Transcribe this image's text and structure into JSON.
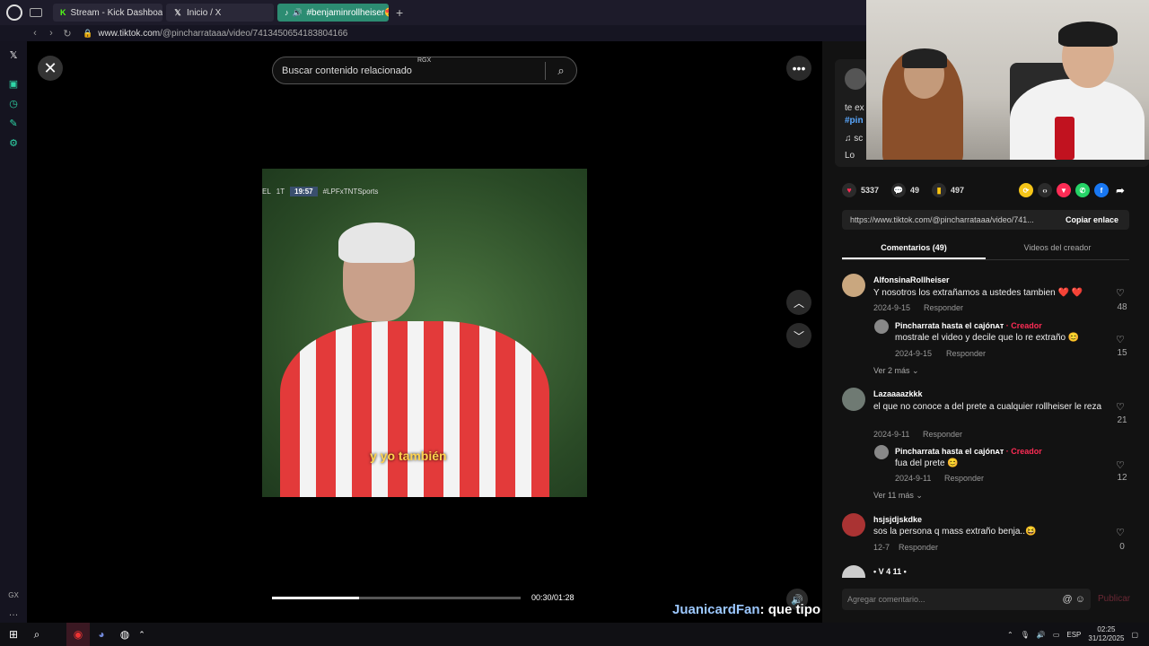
{
  "browser": {
    "tabs": [
      {
        "label": "Stream - Kick Dashboard",
        "icon": "kick-icon"
      },
      {
        "label": "Inicio / X",
        "icon": "x-icon"
      },
      {
        "label": "#benjaminrollheiser😍",
        "icon": "tiktok-icon"
      }
    ],
    "url_host": "www.tiktok.com",
    "url_path": "/@pincharrataaa/video/7413450654183804166",
    "sidebar_bottom_label": "GX"
  },
  "video": {
    "search_placeholder": "Buscar contenido relacionado",
    "rgx_label": "RGX",
    "scorebug_team": "EL",
    "scorebug_half": "1T",
    "scorebug_time": "19:57",
    "scorebug_channel": "#LPFxTNTSports",
    "caption": "y yo también",
    "timecode": "00:30/01:28",
    "progress": 0.35,
    "chat_user": "JuanicardFan",
    "chat_message": ": que tipo con clase"
  },
  "description": {
    "line1": "te ex",
    "line2": "#pin",
    "line3": "♫ sc",
    "line4": "Lo"
  },
  "actions": {
    "likes": "5337",
    "comments": "49",
    "saves": "497"
  },
  "link": {
    "url": "https://www.tiktok.com/@pincharrataaa/video/741...",
    "copy_label": "Copiar enlace"
  },
  "tabs": {
    "comments": "Comentarios (49)",
    "creator_videos": "Videos del creador"
  },
  "comments": [
    {
      "name": "AlfonsinaRollheiser",
      "text": "Y nosotros los extrañamos a ustedes tambien ❤️ ❤️",
      "date": "2024-9-15",
      "reply": "Responder",
      "likes": "48"
    },
    {
      "name": "Pincharrata hasta el cajónᴀᴛ",
      "creator": "· Creador",
      "text": "mostrale el video y decile que lo re extraño 😊",
      "date": "2024-9-15",
      "reply": "Responder",
      "likes": "15"
    },
    {
      "more": "Ver 2 más"
    },
    {
      "name": "Lazaaaazkkk",
      "text": "el que no conoce a del prete a cualquier rollheiser le reza",
      "date": "2024-9-11",
      "reply": "Responder",
      "likes": "21"
    },
    {
      "name": "Pincharrata hasta el cajónᴀᴛ",
      "creator": "· Creador",
      "text": "fua del prete 😊",
      "date": "2024-9-11",
      "reply": "Responder",
      "likes": "12"
    },
    {
      "more": "Ver 11 más"
    },
    {
      "name": "hsjsjdjskdke",
      "text": "sos la persona q mass extraño benja..😆",
      "date": "12-7",
      "reply": "Responder",
      "likes": "0"
    },
    {
      "name": "• V 4 11 •"
    }
  ],
  "add_comment": {
    "placeholder": "Agregar comentario...",
    "publish": "Publicar"
  },
  "taskbar": {
    "lang": "ESP",
    "time": "02:25",
    "date": "31/12/2025"
  }
}
